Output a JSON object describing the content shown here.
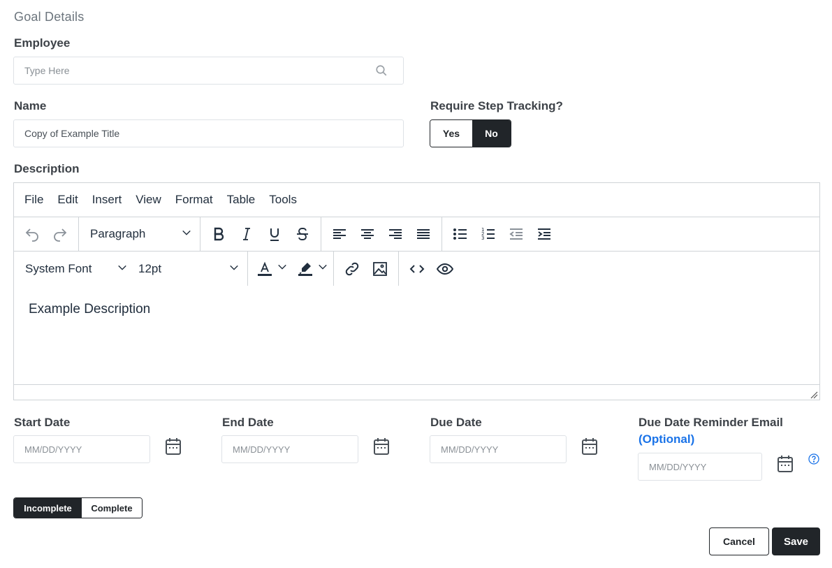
{
  "section_title": "Goal Details",
  "employee": {
    "label": "Employee",
    "placeholder": "Type Here",
    "icon": "search-icon"
  },
  "name": {
    "label": "Name",
    "value": "Copy of Example Title"
  },
  "step_tracking": {
    "label": "Require Step Tracking?",
    "yes": "Yes",
    "no": "No",
    "selected": "No"
  },
  "description": {
    "label": "Description",
    "menu": [
      "File",
      "Edit",
      "Insert",
      "View",
      "Format",
      "Table",
      "Tools"
    ],
    "block_format": "Paragraph",
    "font_family": "System Font",
    "font_size": "12pt",
    "content": "Example Description"
  },
  "dates": {
    "start": {
      "label": "Start Date",
      "placeholder": "MM/DD/YYYY"
    },
    "end": {
      "label": "End Date",
      "placeholder": "MM/DD/YYYY"
    },
    "due": {
      "label": "Due Date",
      "placeholder": "MM/DD/YYYY"
    },
    "reminder": {
      "label": "Due Date Reminder Email",
      "optional": "(Optional)",
      "placeholder": "MM/DD/YYYY"
    }
  },
  "status_toggle": {
    "incomplete": "Incomplete",
    "complete": "Complete",
    "selected": "Incomplete"
  },
  "actions": {
    "cancel": "Cancel",
    "save": "Save"
  },
  "colors": {
    "dark": "#212529",
    "accent": "#1a73e8",
    "border": "#dee2e6"
  }
}
